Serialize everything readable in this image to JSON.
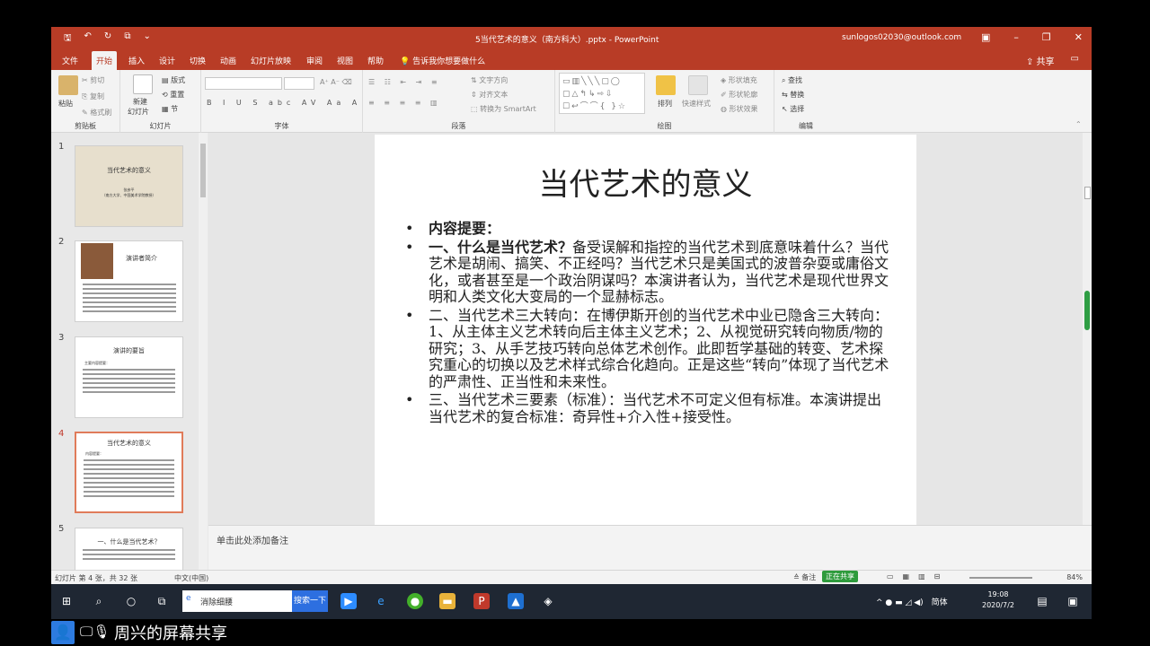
{
  "window": {
    "title": "5当代艺术的意义（南方科大）.pptx - PowerPoint",
    "account": "sunlogos02030@outlook.com"
  },
  "tabs": [
    "文件",
    "开始",
    "插入",
    "设计",
    "切换",
    "动画",
    "幻灯片放映",
    "审阅",
    "视图",
    "帮助"
  ],
  "tell_me": "告诉我你想要做什么",
  "share": "共享",
  "ribbon": {
    "groups": [
      "剪贴板",
      "幻灯片",
      "字体",
      "段落",
      "绘图",
      "编辑"
    ],
    "paste": "粘贴",
    "cut": "剪切",
    "copy": "复制",
    "format_painter": "格式刷",
    "new_slide": "新建",
    "new_slide2": "幻灯片",
    "layout": "版式",
    "reset": "重置",
    "section": "节",
    "text_direction": "文字方向",
    "align_text": "对齐文本",
    "smartart": "转换为 SmartArt",
    "arrange": "排列",
    "quick_styles": "快速样式",
    "shape_fill": "形状填充",
    "shape_outline": "形状轮廓",
    "shape_effects": "形状效果",
    "find": "查找",
    "replace": "替换",
    "select": "选择"
  },
  "thumbnails": [
    {
      "num": "1",
      "title": "当代艺术的意义",
      "sub1": "张彦平",
      "sub2": "（南方大学、中国美术学院教授）"
    },
    {
      "num": "2",
      "title": "演讲者简介"
    },
    {
      "num": "3",
      "title": "演讲的要旨",
      "sub1": "主要内容提要："
    },
    {
      "num": "4",
      "title": "当代艺术的意义",
      "sub1": "内容提要："
    },
    {
      "num": "5",
      "title": "一、什么是当代艺术？"
    }
  ],
  "slide": {
    "title": "当代艺术的意义",
    "b0": "内容提要：",
    "b1_bold": "一、什么是当代艺术？",
    "b1_rest": "备受误解和指控的当代艺术到底意味着什么？当代艺术是胡闹、搞笑、不正经吗？当代艺术只是美国式的波普杂耍或庸俗文化，或者甚至是一个政治阴谋吗？本演讲者认为，当代艺术是现代世界文明和人类文化大变局的一个显赫标志。",
    "b2": "二、当代艺术三大转向：在博伊斯开创的当代艺术中业已隐含三大转向：1、从主体主义艺术转向后主体主义艺术；2、从视觉研究转向物质/物的研究；3、从手艺技巧转向总体艺术创作。此即哲学基础的转变、艺术探究重心的切换以及艺术样式综合化趋向。正是这些“转向”体现了当代艺术的严肃性、正当性和未来性。",
    "b3": "三、当代艺术三要素（标准）：当代艺术不可定义但有标准。本演讲提出当代艺术的复合标准：奇异性+介入性+接受性。"
  },
  "notes_placeholder": "单击此处添加备注",
  "status": {
    "slide_of": "幻灯片 第 4 张，共 32 张",
    "language": "中文(中国)",
    "notes": "备注",
    "badge": "正在共享",
    "zoom": "84%"
  },
  "taskbar": {
    "search_text": "消除细腰",
    "search_button": "搜索一下",
    "lang": "简体",
    "time": "19:08",
    "date": "2020/7/2"
  },
  "share_caption": "周兴的屏幕共享",
  "colors": {
    "accent": "#b83c26",
    "green": "#39d353"
  }
}
